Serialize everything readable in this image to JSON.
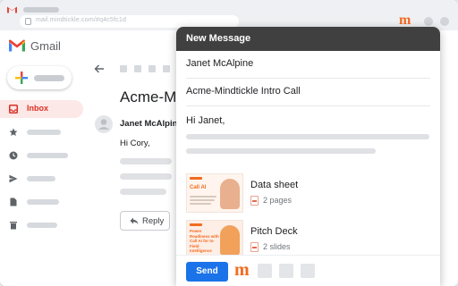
{
  "browser": {
    "url": "mail.mindtickle.com/#q4c5fc1d"
  },
  "app": {
    "name": "Gmail"
  },
  "sidebar": {
    "items": [
      {
        "label": "Inbox",
        "icon": "inbox-icon",
        "active": true
      },
      {
        "label": "",
        "icon": "star-icon"
      },
      {
        "label": "",
        "icon": "clock-icon"
      },
      {
        "label": "",
        "icon": "send-icon"
      },
      {
        "label": "",
        "icon": "file-icon"
      },
      {
        "label": "",
        "icon": "trash-icon"
      }
    ]
  },
  "email": {
    "subject": "Acme-Mind",
    "sender": "Janet McAlpine",
    "greeting": "Hi Cory,",
    "reply_label": "Reply"
  },
  "compose": {
    "title": "New Message",
    "to": "Janet McAlpine",
    "subject": "Acme-Mindtickle Intro Call",
    "greeting": "Hi Janet,",
    "attachments": [
      {
        "name": "Data sheet",
        "pages": "2 pages",
        "thumb_heading": "Call AI"
      },
      {
        "name": "Pitch Deck",
        "pages": "2 slides",
        "thumb_heading": "Power Readiness with Call AI for In-Field Intelligence"
      }
    ],
    "send_label": "Send"
  },
  "colors": {
    "accent": "#1a73e8",
    "brand": "#f26b1f",
    "inbox_active": "#d93025",
    "header": "#404040"
  }
}
